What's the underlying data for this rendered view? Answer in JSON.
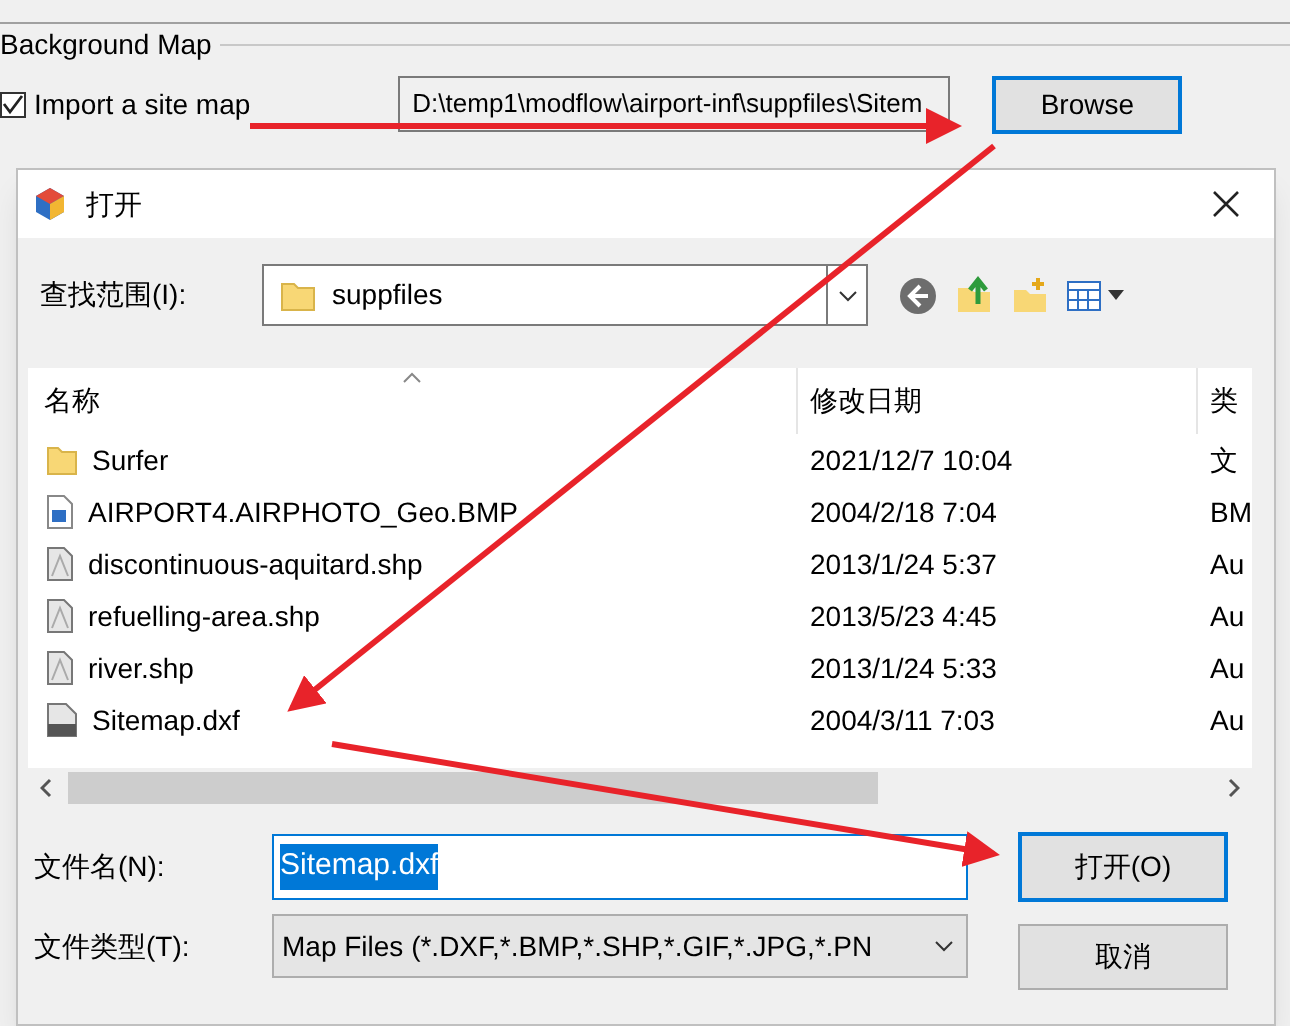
{
  "background_window": {
    "group_title": "Background Map",
    "import_checkbox": {
      "label": "Import a site map",
      "checked": true
    },
    "path_field": {
      "value": "D:\\temp1\\modflow\\airport-inf\\suppfiles\\Sitem"
    },
    "browse_button": {
      "label": "Browse",
      "focused": true
    }
  },
  "dialog": {
    "title": "打开",
    "look_in_label": "查找范围(I):",
    "look_in_value": "suppfiles",
    "columns": [
      "名称",
      "修改日期",
      "类"
    ],
    "files": [
      {
        "kind": "folder",
        "name": "Surfer",
        "modified": "2021/12/7 10:04",
        "type": "文"
      },
      {
        "kind": "image",
        "name": "AIRPORT4.AIRPHOTO_Geo.BMP",
        "modified": "2004/2/18 7:04",
        "type": "BM"
      },
      {
        "kind": "shape",
        "name": "discontinuous-aquitard.shp",
        "modified": "2013/1/24 5:37",
        "type": "Au"
      },
      {
        "kind": "shape",
        "name": "refuelling-area.shp",
        "modified": "2013/5/23 4:45",
        "type": "Au"
      },
      {
        "kind": "shape",
        "name": "river.shp",
        "modified": "2013/1/24 5:33",
        "type": "Au"
      },
      {
        "kind": "dxf",
        "name": "Sitemap.dxf",
        "modified": "2004/3/11 7:03",
        "type": "Au"
      }
    ],
    "file_name_label": "文件名(N):",
    "file_name": {
      "value": "Sitemap.dxf",
      "text_selected": true
    },
    "file_type_label": "文件类型(T):",
    "file_type_value": "Map Files (*.DXF,*.BMP,*.SHP,*.GIF,*.JPG,*.PN",
    "buttons": [
      {
        "label": "打开(O)",
        "default": true
      },
      {
        "label": "取消",
        "default": false
      }
    ]
  }
}
